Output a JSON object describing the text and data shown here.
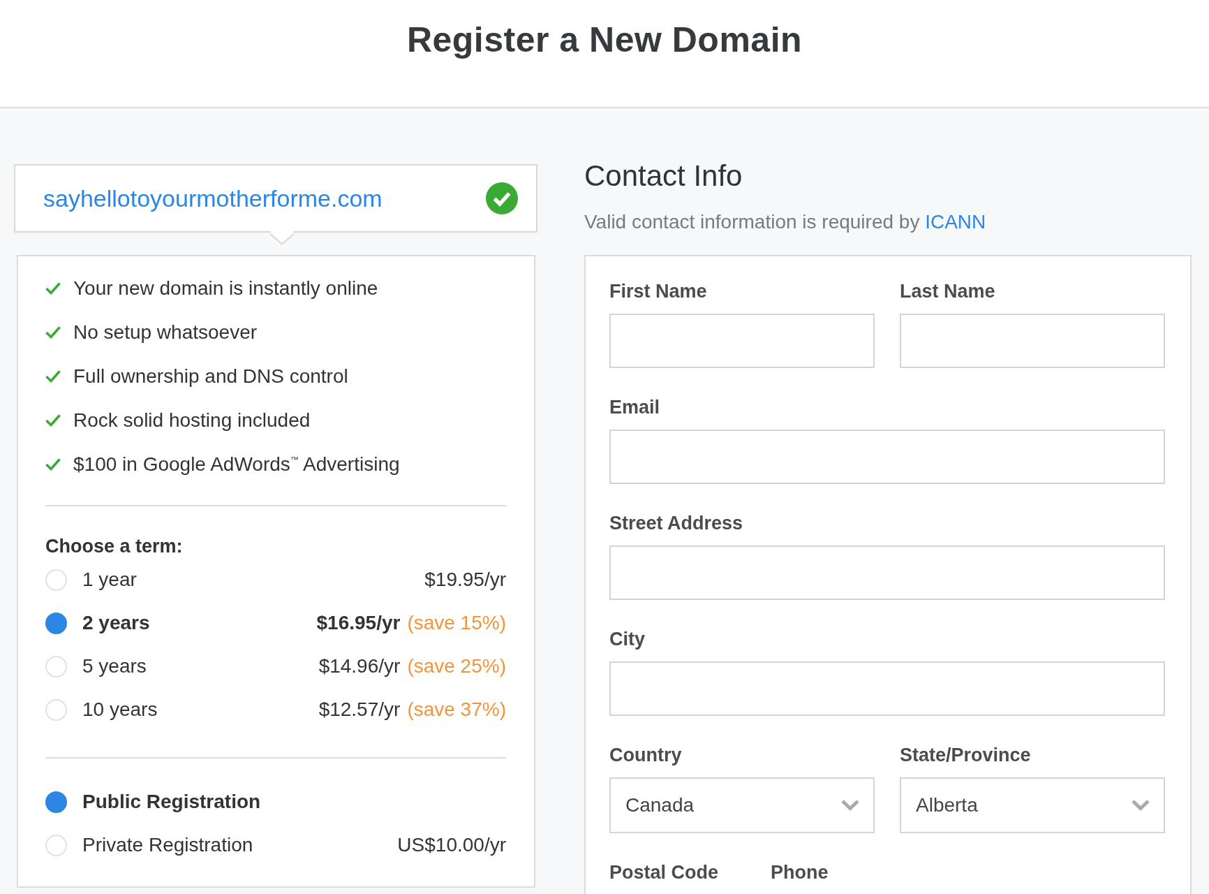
{
  "header": {
    "title": "Register a New Domain"
  },
  "domain": {
    "name": "sayhellotoyourmotherforme.com",
    "available": true
  },
  "features": [
    "Your new domain is instantly online",
    "No setup whatsoever",
    "Full ownership and DNS control",
    "Rock solid hosting included",
    "$100 in Google AdWords$^{™}$ Advertising"
  ],
  "term": {
    "heading": "Choose a term:",
    "options": [
      {
        "label": "1 year",
        "price": "$19.95/yr",
        "selected": false
      },
      {
        "label": "2 years",
        "price": "$16.95/yr",
        "savings": "(save 15%)",
        "selected": true
      },
      {
        "label": "5 years",
        "price": "$14.96/yr",
        "savings": "(save 25%)",
        "selected": false
      },
      {
        "label": "10 years",
        "price": "$12.57/yr",
        "savings": "(save 37%)",
        "selected": false
      }
    ]
  },
  "registration": {
    "options": [
      {
        "label": "Public Registration",
        "selected": true
      },
      {
        "label": "Private Registration",
        "price": "US$10.00/yr",
        "selected": false
      }
    ]
  },
  "contact": {
    "title": "Contact Info",
    "note": "Valid contact information is required by",
    "link": "ICANN",
    "rows": [
      {
        "fields": [
          {
            "label": "First Name",
            "kind": "text"
          },
          {
            "label": "Last Name",
            "kind": "text"
          }
        ]
      },
      {
        "fields": [
          {
            "label": "Email",
            "kind": "text"
          }
        ]
      },
      {
        "fields": [
          {
            "label": "Street Address",
            "kind": "text"
          }
        ]
      },
      {
        "fields": [
          {
            "label": "City",
            "kind": "text"
          }
        ]
      },
      {
        "fields": [
          {
            "label": "Country",
            "kind": "select",
            "value": "Canada"
          },
          {
            "label": "State/Province",
            "kind": "select",
            "value": "Alberta"
          }
        ]
      },
      {
        "fields": [
          {
            "label": "Postal Code"
          },
          {
            "label": "Phone"
          }
        ]
      }
    ]
  }
}
